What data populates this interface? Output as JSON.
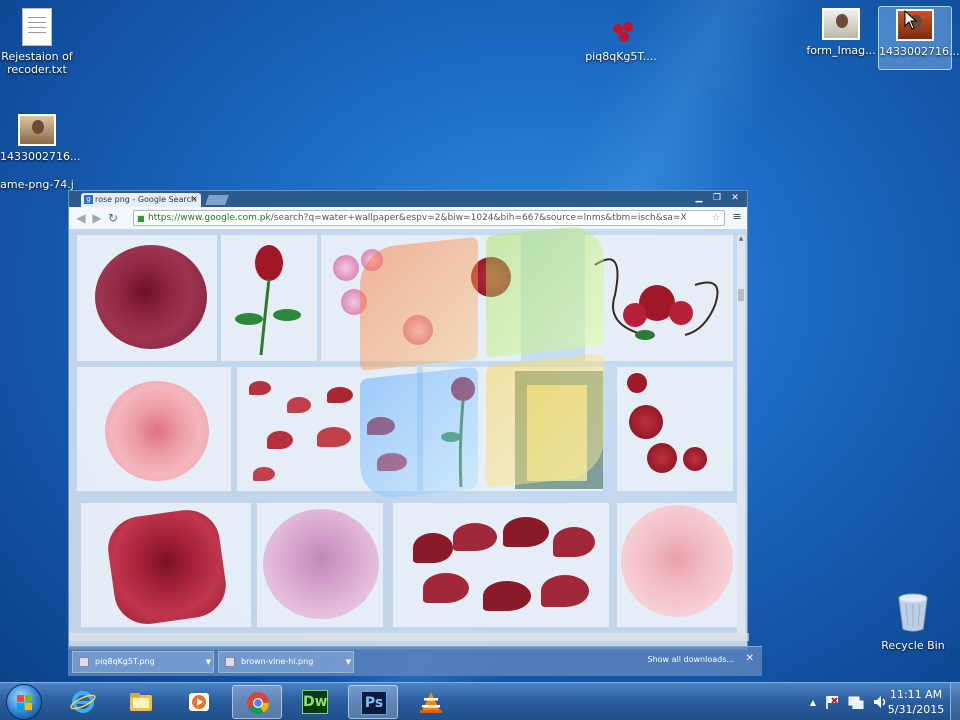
{
  "desktop": {
    "icons": [
      {
        "label": "Rejestaion of recoder.txt",
        "type": "text-file-icon"
      },
      {
        "label": "1433002716...",
        "type": "photo-icon"
      },
      {
        "label": "ame-png-74.j",
        "type": "image-file-icon"
      },
      {
        "label": "piq8qKg5T....",
        "type": "rose-image-icon"
      },
      {
        "label": "form_Imag...",
        "type": "photo-icon"
      },
      {
        "label": "1433002716...",
        "type": "photo-icon"
      },
      {
        "label": "Recycle Bin",
        "type": "recycle-bin-icon"
      }
    ]
  },
  "browser": {
    "tab_title": "rose png - Google Search",
    "tab_close": "×",
    "favicon": "g",
    "url_host": "https://www.google.com.pk",
    "url_path": "/search?q=water+wallpaper&espv=2&biw=1024&bih=667&source=lnms&tbm=isch&sa=X",
    "window_buttons": [
      "▁",
      "❐",
      "✕"
    ],
    "downloads": [
      {
        "name": "piq8qKg5T.png"
      },
      {
        "name": "brown-vine-hi.png"
      }
    ],
    "show_all_downloads": "Show all downloads...",
    "download_close": "✕"
  },
  "taskbar": {
    "pinned": [
      "internet-explorer-icon",
      "file-explorer-icon",
      "media-player-icon",
      "chrome-icon",
      "dreamweaver-icon",
      "photoshop-icon",
      "vlc-icon"
    ],
    "dreamweaver_label": "Dw",
    "photoshop_label": "Ps",
    "time": "11:11 AM",
    "date": "5/31/2015",
    "tray_chevron": "▲"
  },
  "colors": {
    "desktop_blue": "#1c6cc6",
    "taskbar": "#2a5d9e",
    "rose_red": "#a8233a",
    "rose_pink": "#e8a0a8"
  }
}
